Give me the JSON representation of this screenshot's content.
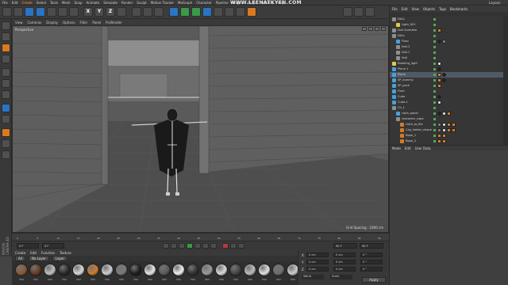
{
  "menubar": {
    "items": [
      "File",
      "Edit",
      "Create",
      "Select",
      "Tools",
      "Mesh",
      "Snap",
      "Animate",
      "Simulate",
      "Render",
      "Sculpt",
      "Motion Tracker",
      "MoGraph",
      "Character",
      "Pipeline",
      "Plugins",
      "Script",
      "Window",
      "Help"
    ],
    "highlight_index": 2,
    "watermark": "WWW.LEEHATKYEN.COM",
    "layout_label": "Layout:"
  },
  "toolbar": {
    "axis_buttons": [
      "X",
      "Y",
      "Z"
    ],
    "colors": {
      "blue": "#2a74c4",
      "orange": "#d97a1f",
      "green": "#3b9a4a"
    }
  },
  "viewport": {
    "menu": [
      "View",
      "Cameras",
      "Display",
      "Options",
      "Filter",
      "Panel",
      "ProRender"
    ],
    "label": "Perspective",
    "grid_spacing": "Grid Spacing : 1000 cm"
  },
  "timeline": {
    "ticks": [
      "0",
      "5",
      "10",
      "15",
      "20",
      "25",
      "30",
      "35",
      "40",
      "45",
      "50",
      "55",
      "60",
      "65",
      "70",
      "75",
      "80",
      "85",
      "90"
    ],
    "start_field": "0 F",
    "current_field": "0 F",
    "end_field": "90 F",
    "end_field2": "90 F"
  },
  "materials": {
    "menu": [
      "Create",
      "Edit",
      "Function",
      "Texture"
    ],
    "tabs": [
      "All",
      "No Layer",
      "Layer"
    ],
    "swatches": [
      {
        "name": "Mat",
        "color": "#8a5a3a"
      },
      {
        "name": "Mat",
        "color": "#6a3a22"
      },
      {
        "name": "Mat",
        "color": "#bfbfbf"
      },
      {
        "name": "Mat",
        "color": "#2a2a2a"
      },
      {
        "name": "Mat",
        "color": "#d8d8d8"
      },
      {
        "name": "Mat",
        "color": "#d27b2a"
      },
      {
        "name": "Mat",
        "color": "#cfcfcf"
      },
      {
        "name": "Mat",
        "color": "#7a7a7a"
      },
      {
        "name": "Mat",
        "color": "#1e1e1e"
      },
      {
        "name": "Mat",
        "color": "#e6e6e6"
      },
      {
        "name": "Mat",
        "color": "#5a5a5a"
      },
      {
        "name": "Mat",
        "color": "#f0f0f0"
      },
      {
        "name": "Mat",
        "color": "#333333"
      },
      {
        "name": "Mat",
        "color": "#9a9a9a"
      },
      {
        "name": "Mat",
        "color": "#dadada"
      },
      {
        "name": "Mat",
        "color": "#444444"
      },
      {
        "name": "Mat",
        "color": "#bcbcbc"
      },
      {
        "name": "Mat",
        "color": "#e0e0e0"
      },
      {
        "name": "Mat",
        "color": "#6e6e6e"
      },
      {
        "name": "Mat",
        "color": "#cccccc"
      }
    ]
  },
  "coords": {
    "rows": [
      {
        "label": "X",
        "a": "0 cm",
        "b": "0 cm",
        "c": "0 °"
      },
      {
        "label": "Y",
        "a": "0 cm",
        "b": "0 cm",
        "c": "0 °"
      },
      {
        "label": "Z",
        "a": "0 cm",
        "b": "0 cm",
        "c": "0 °"
      }
    ],
    "mode": "World",
    "scale_mode": "Scale",
    "apply": "Apply"
  },
  "objects": {
    "header": [
      "File",
      "Edit",
      "View",
      "Objects",
      "Tags",
      "Bookmarks"
    ],
    "rows": [
      {
        "name": "NULL",
        "indent": 0,
        "icon": "#8f8f8f",
        "tags": []
      },
      {
        "name": "Light_001",
        "indent": 1,
        "icon": "#e5c84a",
        "tags": []
      },
      {
        "name": "Null Animatio",
        "indent": 0,
        "icon": "#8f8f8f",
        "tags": [
          "mat-o"
        ]
      },
      {
        "name": "NULL",
        "indent": 0,
        "icon": "#8f8f8f",
        "tags": []
      },
      {
        "name": "Floor",
        "indent": 1,
        "icon": "#4aa0d8",
        "tags": [
          "mat-b",
          "mat-g"
        ]
      },
      {
        "name": "Null.2",
        "indent": 1,
        "icon": "#8f8f8f",
        "tags": []
      },
      {
        "name": "Null.1",
        "indent": 1,
        "icon": "#8f8f8f",
        "tags": []
      },
      {
        "name": "Null",
        "indent": 1,
        "icon": "#8f8f8f",
        "tags": []
      },
      {
        "name": "Rotating_light",
        "indent": 0,
        "icon": "#e5c84a",
        "tags": [
          "mat-w"
        ]
      },
      {
        "name": "Plane.1",
        "indent": 0,
        "icon": "#4aa0d8",
        "tags": [
          "mat-b"
        ]
      },
      {
        "name": "Plane",
        "indent": 0,
        "icon": "#4aa0d8",
        "tags": [
          "mat-o",
          "mat-b"
        ]
      },
      {
        "name": "SP_dummy",
        "indent": 0,
        "icon": "#4aa0d8",
        "tags": [
          "mat-o",
          "mat-b"
        ]
      },
      {
        "name": "SP_pack",
        "indent": 0,
        "icon": "#4aa0d8",
        "tags": [
          "mat-o"
        ]
      },
      {
        "name": "Floor",
        "indent": 0,
        "icon": "#4aa0d8",
        "tags": []
      },
      {
        "name": "Cube",
        "indent": 0,
        "icon": "#4aa0d8",
        "tags": [
          "mat-b"
        ]
      },
      {
        "name": "Cube.1",
        "indent": 0,
        "icon": "#4aa0d8",
        "tags": [
          "mat-w"
        ]
      },
      {
        "name": "Ch_1",
        "indent": 0,
        "icon": "#8f8f8f",
        "tags": []
      },
      {
        "name": "cloth_panel",
        "indent": 1,
        "icon": "#4aa0d8",
        "tags": [
          "mat-b",
          "mat-w",
          "mat-o"
        ]
      },
      {
        "name": "character_cape",
        "indent": 1,
        "icon": "#8f8f8f",
        "tags": []
      },
      {
        "name": "cloth_to_file",
        "indent": 2,
        "icon": "#d27b2a",
        "tags": [
          "mat-g",
          "mat-w",
          "mat-o",
          "mat-o"
        ]
      },
      {
        "name": "Cap_holder_shape",
        "indent": 2,
        "icon": "#d27b2a",
        "tags": [
          "mat-g",
          "mat-w",
          "mat-o",
          "mat-o"
        ]
      },
      {
        "name": "Rope_1",
        "indent": 2,
        "icon": "#d27b2a",
        "tags": [
          "mat-o",
          "mat-o"
        ]
      },
      {
        "name": "Rope_2",
        "indent": 2,
        "icon": "#d27b2a",
        "tags": [
          "mat-o",
          "mat-o"
        ]
      }
    ],
    "selected_index": 10
  },
  "attributes": {
    "header": [
      "Mode",
      "Edit",
      "User Data"
    ]
  }
}
